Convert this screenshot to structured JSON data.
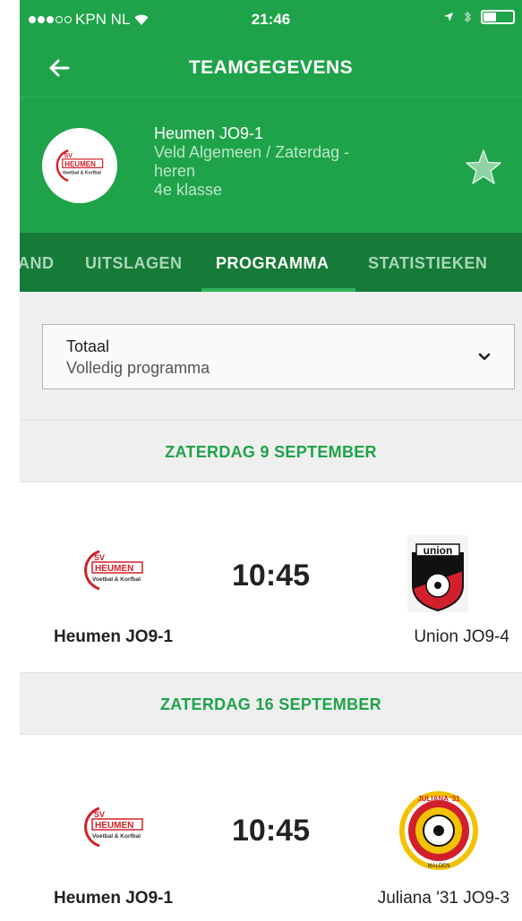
{
  "status_bar": {
    "carrier": "KPN NL",
    "time": "21:46"
  },
  "nav": {
    "title": "TEAMGEGEVENS"
  },
  "team": {
    "name": "Heumen JO9‑1",
    "line2": "Veld Algemeen / Zaterdag ‑",
    "line3": "heren",
    "line4": "4e klasse"
  },
  "tabs": [
    {
      "label": "AND",
      "active": false
    },
    {
      "label": "UITSLAGEN",
      "active": false
    },
    {
      "label": "PROGRAMMA",
      "active": true
    },
    {
      "label": "STATISTIEKEN",
      "active": false
    }
  ],
  "filter": {
    "title": "Totaal",
    "value": "Volledig programma"
  },
  "logo": {
    "sv": "SV",
    "heumen": "HEUMEN",
    "tagline": "Voetbal & Korfbal",
    "union": "union",
    "juliana": "JULIANA '31",
    "malden": "MALDEN"
  },
  "days": [
    {
      "date": "ZATERDAG 9 SEPTEMBER",
      "match": {
        "home": "Heumen JO9‑1",
        "time": "10:45",
        "away": "Union JO9‑4"
      }
    },
    {
      "date": "ZATERDAG 16 SEPTEMBER",
      "match": {
        "home": "Heumen JO9‑1",
        "time": "10:45",
        "away": "Juliana '31 JO9‑3"
      }
    }
  ],
  "colors": {
    "primary_green": "#1fa34a",
    "dark_green": "#167a38",
    "heumen_red": "#d32027",
    "union_red": "#d11f2c"
  }
}
